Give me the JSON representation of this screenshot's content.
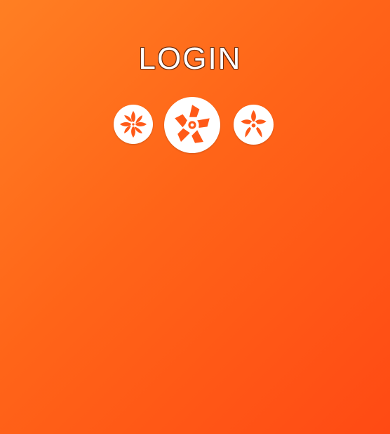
{
  "login": {
    "title": "LOGIN"
  },
  "icons": [
    {
      "name": "leaf-flower-icon"
    },
    {
      "name": "swirl-pentagon-icon"
    },
    {
      "name": "star-flower-icon"
    }
  ],
  "colors": {
    "background_start": "#ff7f23",
    "background_end": "#ff4a14",
    "icon_background": "#ffffff",
    "icon_foreground": "#ff5a18"
  }
}
